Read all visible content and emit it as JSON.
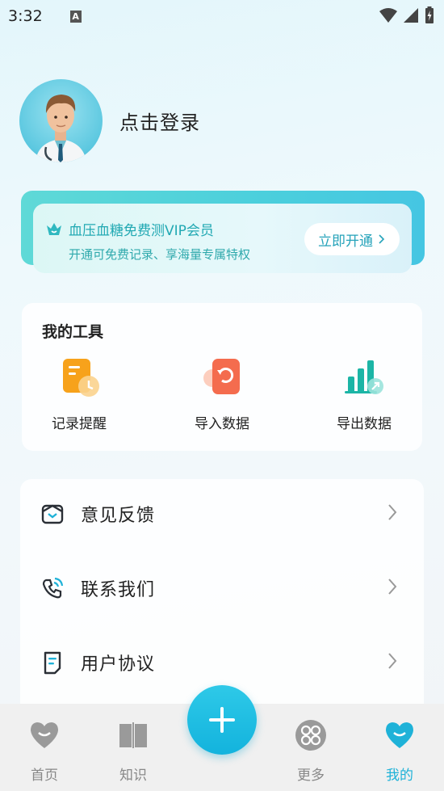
{
  "status_bar": {
    "time": "3:32",
    "notification_letter": "A"
  },
  "profile": {
    "login_text": "点击登录"
  },
  "vip": {
    "title": "血压血糖免费测VIP会员",
    "subtitle": "开通可免费记录、享海量专属特权",
    "button_label": "立即开通"
  },
  "tools": {
    "title": "我的工具",
    "items": [
      {
        "label": "记录提醒",
        "icon": "reminder-icon"
      },
      {
        "label": "导入数据",
        "icon": "import-icon"
      },
      {
        "label": "导出数据",
        "icon": "export-icon"
      }
    ]
  },
  "menu": {
    "items": [
      {
        "label": "意见反馈",
        "icon": "feedback-icon"
      },
      {
        "label": "联系我们",
        "icon": "phone-icon"
      },
      {
        "label": "用户协议",
        "icon": "document-icon"
      }
    ]
  },
  "tabbar": {
    "items": [
      {
        "label": "首页",
        "icon": "heart-icon",
        "active": false
      },
      {
        "label": "知识",
        "icon": "book-icon",
        "active": false
      },
      {
        "label": "更多",
        "icon": "grid-icon",
        "active": false
      },
      {
        "label": "我的",
        "icon": "heart-smile-icon",
        "active": true
      }
    ],
    "fab_icon": "plus-icon"
  },
  "colors": {
    "accent": "#1fb2d8",
    "vip_text": "#22a9b3"
  }
}
